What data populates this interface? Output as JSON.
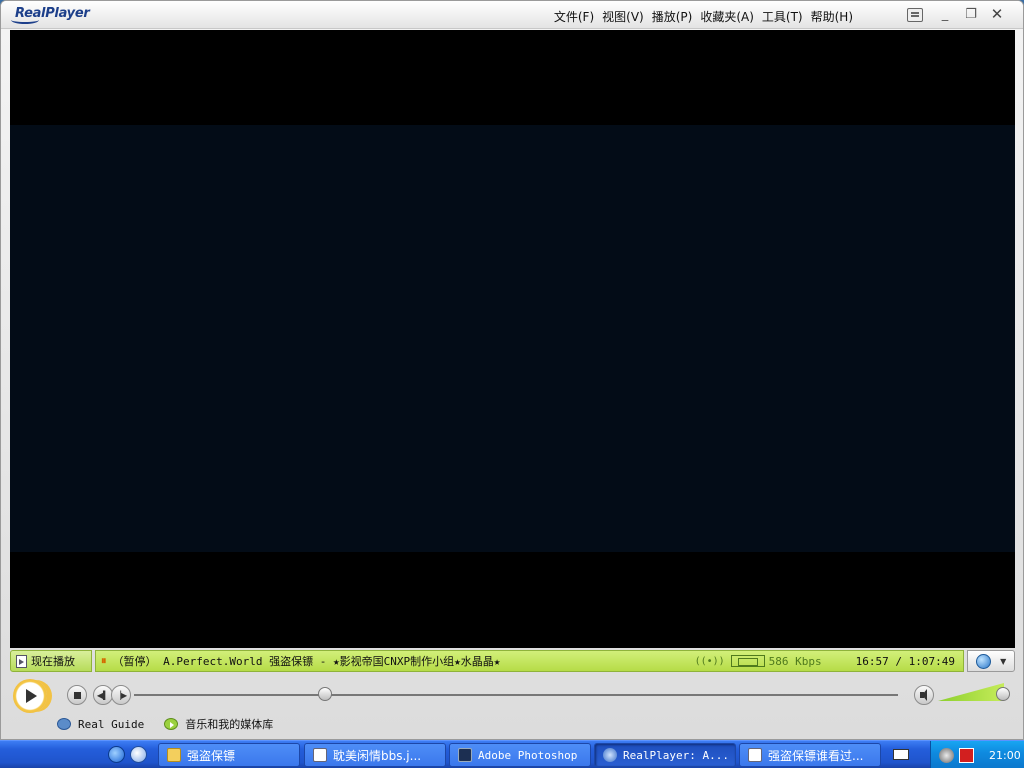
{
  "window": {
    "app_name": "RealPlayer",
    "menu": [
      "文件(F)",
      "视图(V)",
      "播放(P)",
      "收藏夹(A)",
      "工具(T)",
      "帮助(H)"
    ],
    "controls": {
      "minimize": "_",
      "restore": "❐",
      "close": "✕"
    }
  },
  "status": {
    "tab_label": "现在播放",
    "state": "（暂停）",
    "clip_title": "A.Perfect.World 强盗保镖 - ★影视帝国CNXP制作小组★水晶晶★",
    "signal": "((•))",
    "bitrate": "586 Kbps",
    "time": "16:57 / 1:07:49"
  },
  "transport": {
    "position_fraction": 0.25,
    "volume_fraction": 1.0
  },
  "links": {
    "guide": "Real Guide",
    "library": "音乐和我的媒体库"
  },
  "taskbar": {
    "tasks": [
      {
        "label": "强盗保镖",
        "icon": "folder-icon",
        "active": false
      },
      {
        "label": "耽美闲情bbs.j...",
        "icon": "document-icon",
        "active": false
      },
      {
        "label": "Adobe Photoshop",
        "icon": "photoshop-icon",
        "active": false
      },
      {
        "label": "RealPlayer: A...",
        "icon": "realplayer-icon",
        "active": true
      },
      {
        "label": "强盗保镖谁看过...",
        "icon": "document-icon",
        "active": false
      }
    ],
    "clock": "21:00"
  },
  "colors": {
    "status_green": "#c2e45a",
    "taskbar_blue": "#245edb",
    "accent_orange": "#e8a51a"
  }
}
